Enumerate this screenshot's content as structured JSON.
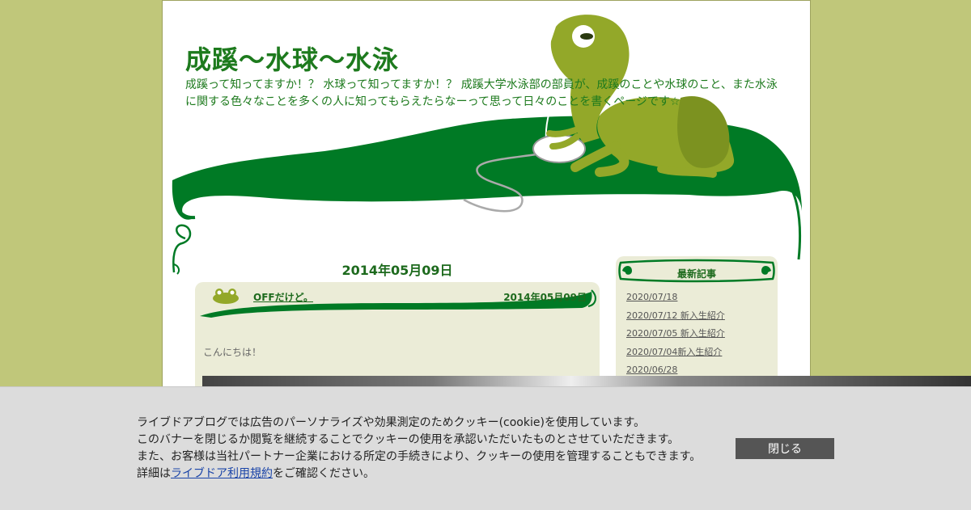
{
  "blog": {
    "title": "成蹊～水球～水泳",
    "description": "成蹊って知ってますか！？ 水球って知ってますか！？ 成蹊大学水泳部の部員が、成蹊のことや水球のこと、また水泳に関する色々なことを多くの人に知ってもらえたらなーって思って日々のことを書くページです☆"
  },
  "main": {
    "date_heading": "2014年05月09日",
    "article": {
      "title": "OFFだけど。",
      "date": "2014年05月09日",
      "body": "こんにちは！"
    }
  },
  "sidebar": {
    "title": "最新記事",
    "items": [
      "2020/07/18",
      "2020/07/12 新入生紹介",
      "2020/07/05 新入生紹介",
      "2020/07/04新入生紹介",
      "2020/06/28"
    ]
  },
  "cookie_banner": {
    "line1": "ライブドアブログでは広告のパーソナライズや効果測定のためクッキー(cookie)を使用しています。",
    "line2": "このバナーを閉じるか閲覧を継続することでクッキーの使用を承認いただいたものとさせていただきます。",
    "line3": "また、お客様は当社パートナー企業における所定の手続きにより、クッキーの使用を管理することもできます。",
    "line4_prefix": "詳細は",
    "link_text": "ライブドア利用規約",
    "line4_suffix": "をご確認ください。",
    "close_label": "閉じる"
  },
  "colors": {
    "background": "#c0c77a",
    "leaf": "#007a25",
    "frog": "#93a829",
    "title": "#1d7a1d",
    "panel": "#ebecd7",
    "banner": "#dcdcdc",
    "close_button": "#555555"
  }
}
